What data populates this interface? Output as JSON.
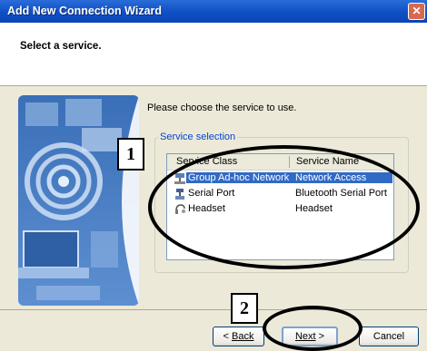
{
  "window": {
    "title": "Add New Connection Wizard"
  },
  "header": {
    "heading": "Select a service."
  },
  "main": {
    "prompt": "Please choose the service to use.",
    "group_label": "Service selection",
    "list": {
      "columns": [
        "Service Class",
        "Service Name"
      ],
      "rows": [
        {
          "class": "Group Ad-hoc Network",
          "name": "Network Access",
          "icon": "network-icon",
          "selected": true
        },
        {
          "class": "Serial Port",
          "name": "Bluetooth Serial Port",
          "icon": "serial-port-icon",
          "selected": false
        },
        {
          "class": "Headset",
          "name": "Headset",
          "icon": "headset-icon",
          "selected": false
        }
      ]
    }
  },
  "buttons": {
    "back": "Back",
    "back_prefix": "< ",
    "next": "Next",
    "next_suffix": " >",
    "cancel": "Cancel"
  },
  "annotations": {
    "callout_1": "1",
    "callout_2": "2"
  },
  "colors": {
    "title_bar": "#0f4fc4",
    "selection": "#316ac5",
    "group_label": "#0046d5"
  }
}
